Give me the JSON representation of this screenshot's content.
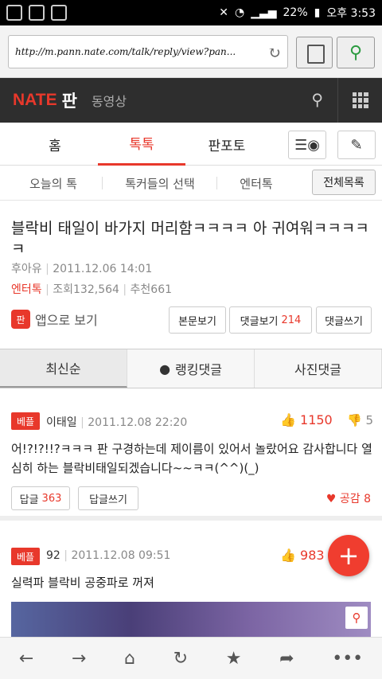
{
  "status_bar": {
    "battery": "22%",
    "time": "오후 3:53"
  },
  "browser": {
    "url": "http://m.pann.nate.com/talk/reply/view?pan..."
  },
  "header": {
    "logo": "NATE",
    "brand": "판",
    "video": "동영상"
  },
  "main_tabs": [
    {
      "label": "홈"
    },
    {
      "label": "톡톡"
    },
    {
      "label": "판포토"
    }
  ],
  "sub_tabs": [
    {
      "label": "오늘의 톡"
    },
    {
      "label": "톡커들의 선택"
    },
    {
      "label": "엔터톡"
    }
  ],
  "all_list": "전체목록",
  "article": {
    "title": "블락비 태일이 바가지 머리함ㅋㅋㅋㅋ 아 귀여워ㅋㅋㅋㅋㅋ",
    "author": "후아유",
    "date": "2011.12.06 14:01",
    "category": "엔터톡",
    "views": "조회132,564",
    "recommend": "추천661",
    "app_view": "앱으로 보기",
    "app_icon": "판",
    "btn_view": "본문보기",
    "btn_reply": "댓글보기",
    "reply_count": "214",
    "btn_write": "댓글쓰기"
  },
  "sort_tabs": [
    {
      "label": "최신순"
    },
    {
      "label": "랭킹댓글"
    },
    {
      "label": "사진댓글"
    }
  ],
  "comments": [
    {
      "badge": "베플",
      "user": "이태일",
      "date": "2011.12.08 22:20",
      "likes": "1150",
      "dislikes": "5",
      "text": "어!?!?!!?ㅋㅋㅋ 판 구경하는데 제이름이 있어서 놀랐어요 감사합니다 열심히 하는 블락비태일되겠습니다~~ㅋㅋ(^^)(_)",
      "reply_label": "답글",
      "reply_count": "363",
      "reply_write": "답글쓰기",
      "empathy": "공감 8"
    },
    {
      "badge": "베플",
      "user": "92",
      "date": "2011.12.08 09:51",
      "likes": "983",
      "text": "실력파 블락비 공중파로 꺼져"
    }
  ],
  "fab": "+",
  "colors": {
    "accent": "#e8382b",
    "header_bg": "#2e2e2e"
  }
}
